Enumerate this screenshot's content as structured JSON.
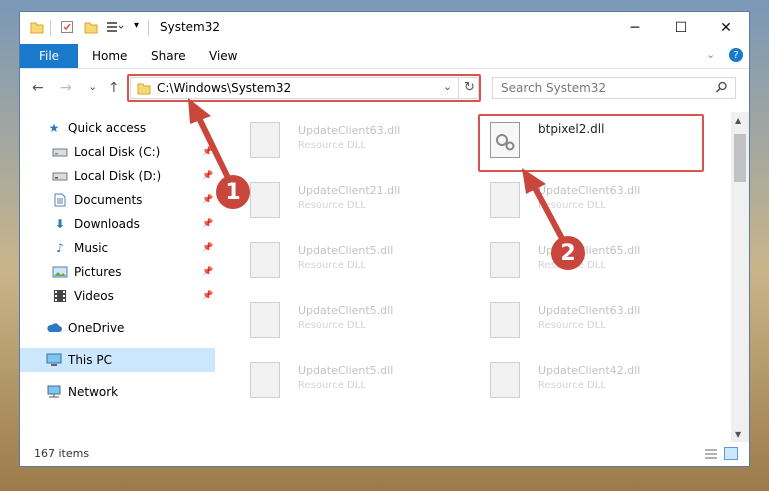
{
  "window": {
    "title": "System32",
    "controls": {
      "minimize": "─",
      "maximize": "☐",
      "close": "✕"
    }
  },
  "ribbon": {
    "file": "File",
    "tabs": [
      "Home",
      "Share",
      "View"
    ],
    "help": "?"
  },
  "navigation": {
    "back": "←",
    "forward": "→",
    "recent": "⌄",
    "up": "↑",
    "address": "C:\\Windows\\System32",
    "refresh": "↻",
    "dropdown": "⌄",
    "search_placeholder": "Search System32"
  },
  "sidebar": {
    "quick_access": "Quick access",
    "items": [
      {
        "label": "Local Disk (C:)",
        "icon": "drive-icon"
      },
      {
        "label": "Local Disk (D:)",
        "icon": "drive-icon"
      },
      {
        "label": "Documents",
        "icon": "documents-icon"
      },
      {
        "label": "Downloads",
        "icon": "downloads-icon"
      },
      {
        "label": "Music",
        "icon": "music-icon"
      },
      {
        "label": "Pictures",
        "icon": "pictures-icon"
      },
      {
        "label": "Videos",
        "icon": "videos-icon"
      }
    ],
    "onedrive": "OneDrive",
    "this_pc": "This PC",
    "network": "Network"
  },
  "files": [
    {
      "name": "UpdateClient63.dll",
      "type": "Resource DLL"
    },
    {
      "name": "btpixel2.dll",
      "type": ""
    },
    {
      "name": "UpdateClient21.dll",
      "type": "Resource DLL"
    },
    {
      "name": "UpdateClient63.dll",
      "type": "Resource DLL"
    },
    {
      "name": "UpdateClient5.dll",
      "type": "Resource DLL"
    },
    {
      "name": "UpdateClient65.dll",
      "type": "Resource DLL"
    },
    {
      "name": "UpdateClient5.dll",
      "type": "Resource DLL"
    },
    {
      "name": "UpdateClient63.dll",
      "type": "Resource DLL"
    },
    {
      "name": "UpdateClient5.dll",
      "type": "Resource DLL"
    },
    {
      "name": "UpdateClient42.dll",
      "type": "Resource DLL"
    }
  ],
  "status": {
    "items": "167 items"
  },
  "annotations": {
    "badge1": "1",
    "badge2": "2",
    "color": "#c9463d"
  }
}
